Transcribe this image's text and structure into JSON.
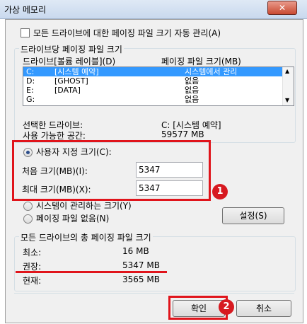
{
  "window": {
    "title": "가상 메모리",
    "close": "✕"
  },
  "auto_manage": {
    "label": "모든 드라이브에 대한 페이징 파일 크기 자동 관리(A)",
    "checked": false
  },
  "per_drive": {
    "group_label": "드라이브당 페이징 파일 크기",
    "col_drive": "드라이브[볼륨 레이블](D)",
    "col_size": "페이징 파일 크기(MB)",
    "rows": [
      {
        "drive": "C:",
        "label": "[시스템 예약]",
        "size": "시스템에서 관리",
        "selected": true
      },
      {
        "drive": "D:",
        "label": "[GHOST]",
        "size": "없음",
        "selected": false
      },
      {
        "drive": "E:",
        "label": "[DATA]",
        "size": "없음",
        "selected": false
      },
      {
        "drive": "G:",
        "label": "",
        "size": "없음",
        "selected": false
      }
    ],
    "selected_drive_label": "선택한 드라이브:",
    "selected_drive_value": "C:  [시스템 예약]",
    "free_space_label": "사용 가능한 공간:",
    "free_space_value": "59577 MB"
  },
  "custom": {
    "radio_label": "사용자 지정 크기(C):",
    "selected": true,
    "initial_label": "처음 크기(MB)(I):",
    "initial_value": "5347",
    "max_label": "최대 크기(MB)(X):",
    "max_value": "5347"
  },
  "system_managed": {
    "label": "시스템이 관리하는 크기(Y)"
  },
  "no_paging": {
    "label": "페이징 파일 없음(N)"
  },
  "set_button": "설정(S)",
  "totals": {
    "group_label": "모든 드라이브의 총 페이징 파일 크기",
    "min_label": "최소:",
    "min_value": "16 MB",
    "rec_label": "권장:",
    "rec_value": "5347 MB",
    "cur_label": "현재:",
    "cur_value": "3565 MB"
  },
  "ok_button": "확인",
  "cancel_button": "취소",
  "badges": {
    "one": "1",
    "two": "2"
  },
  "accent_red": "#e0141b",
  "selection_blue": "#3399ff"
}
